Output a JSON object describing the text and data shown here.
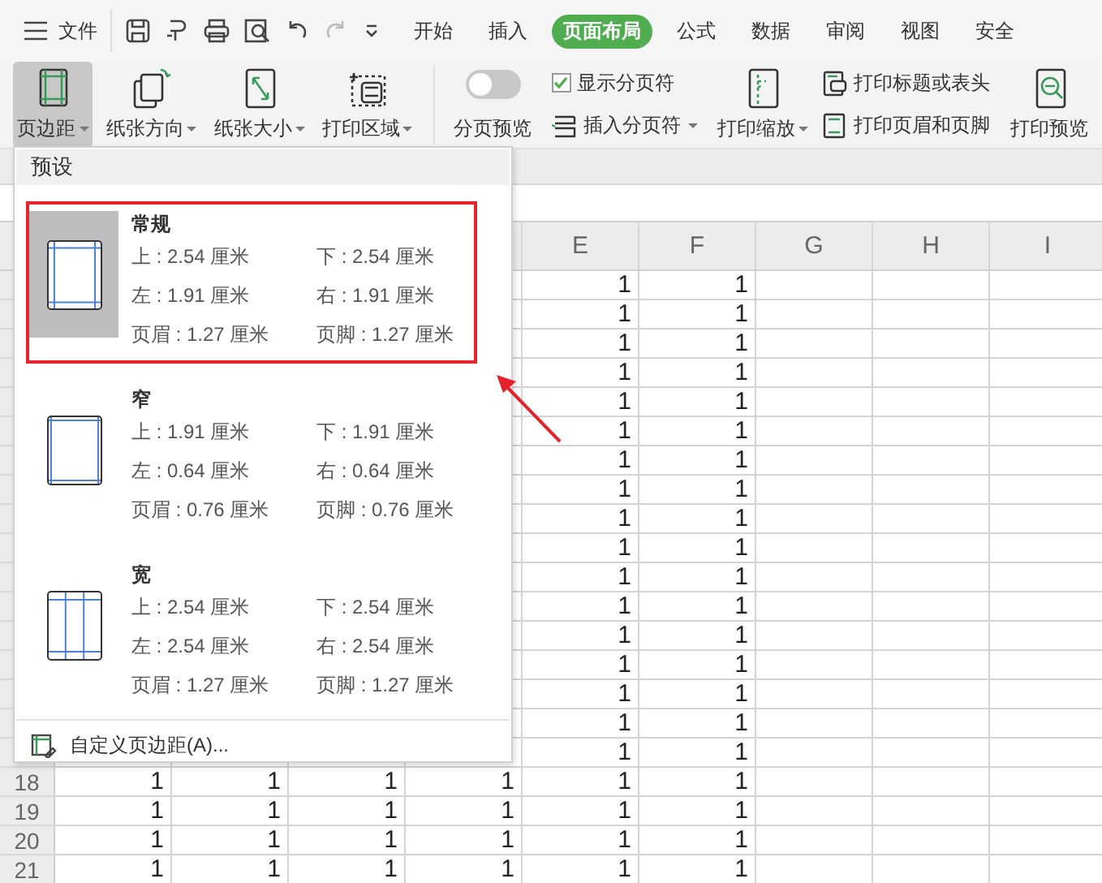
{
  "menu_bar": {
    "file_label": "文件",
    "tabs": [
      {
        "label": "开始",
        "selected": false
      },
      {
        "label": "插入",
        "selected": false
      },
      {
        "label": "页面布局",
        "selected": true
      },
      {
        "label": "公式",
        "selected": false
      },
      {
        "label": "数据",
        "selected": false
      },
      {
        "label": "审阅",
        "selected": false
      },
      {
        "label": "视图",
        "selected": false
      },
      {
        "label": "安全",
        "selected": false
      }
    ]
  },
  "ribbon": [
    {
      "kind": "large",
      "label": "页边距",
      "dropdown": true,
      "pressed": true
    },
    {
      "kind": "large",
      "label": "纸张方向",
      "dropdown": true,
      "pressed": false
    },
    {
      "kind": "large",
      "label": "纸张大小",
      "dropdown": true,
      "pressed": false
    },
    {
      "kind": "large",
      "label": "打印区域",
      "dropdown": true,
      "pressed": false
    },
    {
      "kind": "separator"
    },
    {
      "kind": "toggle",
      "label": "分页预览",
      "on": false
    },
    {
      "kind": "stack",
      "items": [
        {
          "kind": "checkbox",
          "label": "显示分页符",
          "checked": true
        },
        {
          "kind": "small",
          "label": "插入分页符",
          "dropdown": true
        }
      ]
    },
    {
      "kind": "large",
      "label": "打印缩放",
      "dropdown": true,
      "pressed": false
    },
    {
      "kind": "stack",
      "items": [
        {
          "kind": "small",
          "label": "打印标题或表头",
          "dropdown": false
        },
        {
          "kind": "small",
          "label": "打印页眉和页脚",
          "dropdown": false
        }
      ]
    },
    {
      "kind": "large",
      "label": "打印预览",
      "dropdown": false,
      "pressed": false
    }
  ],
  "sheet": {
    "column_headers": [
      "E",
      "F",
      "G",
      "H",
      "I"
    ],
    "rows": [
      {
        "cells": [
          null,
          null,
          null,
          null,
          "1",
          "1",
          null,
          null,
          null
        ]
      },
      {
        "cells": [
          null,
          null,
          null,
          null,
          "1",
          "1",
          null,
          null,
          null
        ]
      },
      {
        "cells": [
          null,
          null,
          null,
          null,
          "1",
          "1",
          null,
          null,
          null
        ]
      },
      {
        "cells": [
          null,
          null,
          null,
          null,
          "1",
          "1",
          null,
          null,
          null
        ]
      },
      {
        "cells": [
          null,
          null,
          null,
          null,
          "1",
          "1",
          null,
          null,
          null
        ]
      },
      {
        "cells": [
          null,
          null,
          null,
          null,
          "1",
          "1",
          null,
          null,
          null
        ]
      },
      {
        "cells": [
          null,
          null,
          null,
          null,
          "1",
          "1",
          null,
          null,
          null
        ]
      },
      {
        "cells": [
          null,
          null,
          null,
          null,
          "1",
          "1",
          null,
          null,
          null
        ]
      },
      {
        "cells": [
          null,
          null,
          null,
          null,
          "1",
          "1",
          null,
          null,
          null
        ]
      },
      {
        "cells": [
          null,
          null,
          null,
          null,
          "1",
          "1",
          null,
          null,
          null
        ]
      },
      {
        "cells": [
          null,
          null,
          null,
          null,
          "1",
          "1",
          null,
          null,
          null
        ]
      },
      {
        "cells": [
          null,
          null,
          null,
          null,
          "1",
          "1",
          null,
          null,
          null
        ]
      },
      {
        "cells": [
          null,
          null,
          null,
          null,
          "1",
          "1",
          null,
          null,
          null
        ]
      },
      {
        "cells": [
          null,
          null,
          null,
          null,
          "1",
          "1",
          null,
          null,
          null
        ]
      },
      {
        "cells": [
          null,
          null,
          null,
          null,
          "1",
          "1",
          null,
          null,
          null
        ]
      },
      {
        "cells": [
          null,
          null,
          null,
          null,
          "1",
          "1",
          null,
          null,
          null
        ]
      },
      {
        "cells": [
          null,
          null,
          null,
          null,
          "1",
          "1",
          null,
          null,
          null
        ]
      },
      {
        "number": "18",
        "cells": [
          "1",
          "1",
          "1",
          "1",
          "1",
          "1",
          null,
          null,
          null
        ]
      },
      {
        "number": "19",
        "cells": [
          "1",
          "1",
          "1",
          "1",
          "1",
          "1",
          null,
          null,
          null
        ]
      },
      {
        "number": "20",
        "cells": [
          "1",
          "1",
          "1",
          "1",
          "1",
          "1",
          null,
          null,
          null
        ]
      },
      {
        "number": "21",
        "cells": [
          "1",
          "1",
          "1",
          "1",
          "1",
          "1",
          null,
          null,
          null
        ]
      }
    ]
  },
  "margin_menu": {
    "section_title": "预设",
    "presets": [
      {
        "name": "常规",
        "kind": "normal",
        "selected": true,
        "highlighted": true,
        "values": [
          "上 : 2.54 厘米",
          "下 : 2.54 厘米",
          "左 : 1.91 厘米",
          "右 : 1.91 厘米",
          "页眉 : 1.27 厘米",
          "页脚 : 1.27 厘米"
        ]
      },
      {
        "name": "窄",
        "kind": "narrow",
        "selected": false,
        "highlighted": false,
        "values": [
          "上 : 1.91 厘米",
          "下 : 1.91 厘米",
          "左 : 0.64 厘米",
          "右 : 0.64 厘米",
          "页眉 : 0.76 厘米",
          "页脚 : 0.76 厘米"
        ]
      },
      {
        "name": "宽",
        "kind": "wide",
        "selected": false,
        "highlighted": false,
        "values": [
          "上 : 2.54 厘米",
          "下 : 2.54 厘米",
          "左 : 2.54 厘米",
          "右 : 2.54 厘米",
          "页眉 : 1.27 厘米",
          "页脚 : 1.27 厘米"
        ]
      }
    ],
    "custom_label": "自定义页边距(A)..."
  }
}
